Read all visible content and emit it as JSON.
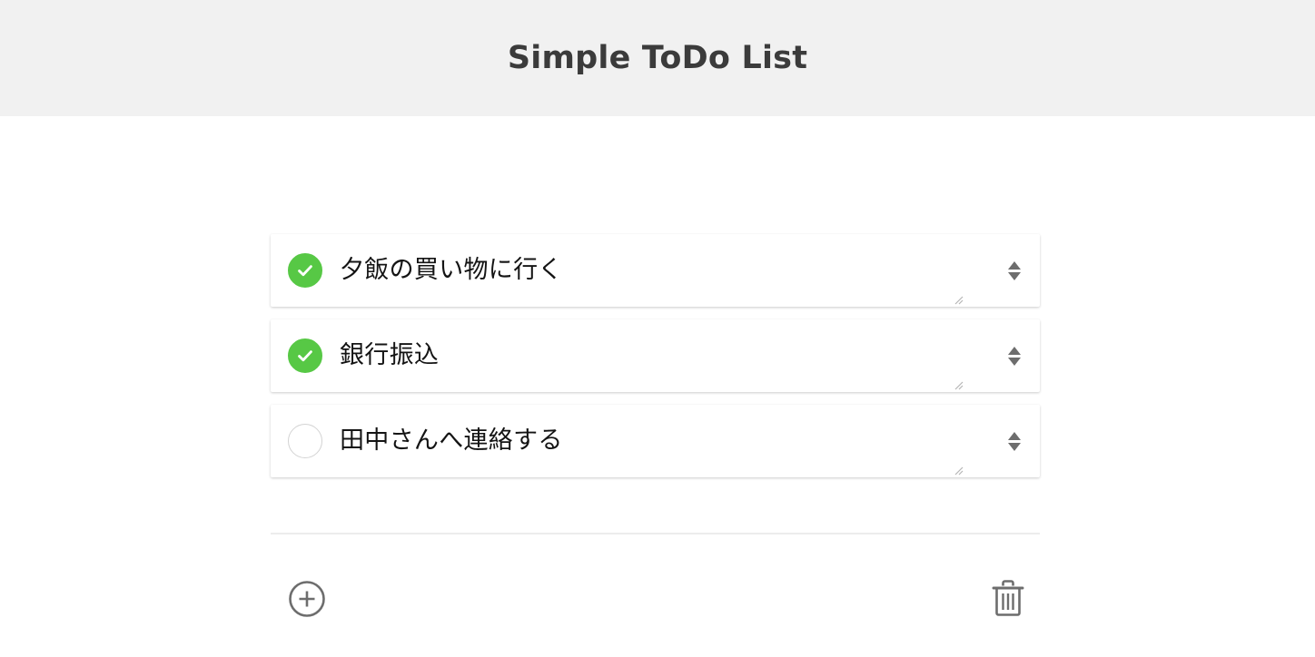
{
  "header": {
    "title": "Simple ToDo List"
  },
  "colors": {
    "header_bg": "#f1f1f1",
    "page_bg": "#ffffff",
    "title_text": "#3b3b3b",
    "checked_green": "#57c845",
    "unchecked_border": "#d3d3d3",
    "item_text": "#141414",
    "icon_gray": "#6d6d6d",
    "divider": "#ececec"
  },
  "list": {
    "items": [
      {
        "label": "夕飯の買い物に行く",
        "checked": true,
        "check_icon": "check-circle-filled-icon",
        "stepper_icon": "up-down-stepper-icon",
        "resize_icon": "resize-grip-icon"
      },
      {
        "label": "銀行振込",
        "checked": true,
        "check_icon": "check-circle-filled-icon",
        "stepper_icon": "up-down-stepper-icon",
        "resize_icon": "resize-grip-icon"
      },
      {
        "label": "田中さんへ連絡する",
        "checked": false,
        "check_icon": "circle-outline-icon",
        "stepper_icon": "up-down-stepper-icon",
        "resize_icon": "resize-grip-icon"
      }
    ]
  },
  "toolbar": {
    "add_icon": "plus-circle-icon",
    "delete_icon": "trash-icon"
  }
}
